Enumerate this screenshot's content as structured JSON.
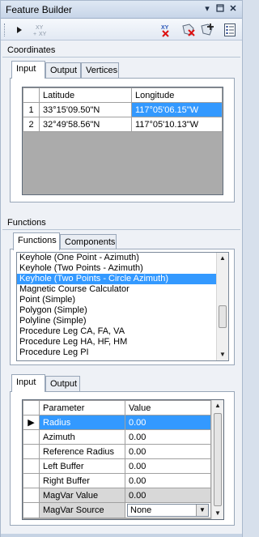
{
  "window": {
    "title": "Feature Builder"
  },
  "titlebar_buttons": [
    "dropdown-icon",
    "pin-icon",
    "close-icon"
  ],
  "toolbar": {
    "tools": [
      "select-arrow-icon",
      "xy-to-xy-icon",
      "clear-xy-icon",
      "delete-feature-icon",
      "add-feature-icon",
      "properties-icon"
    ],
    "xy_label": "XY"
  },
  "coordinates": {
    "label": "Coordinates",
    "tabs": [
      "Input",
      "Output",
      "Vertices"
    ],
    "active_tab": "Input",
    "columns": [
      "Latitude",
      "Longitude"
    ],
    "rows": [
      {
        "index": "1",
        "latitude": "33°15'09.50\"N",
        "longitude": "117°05'06.15\"W"
      },
      {
        "index": "2",
        "latitude": "32°49'58.56\"N",
        "longitude": "117°05'10.13\"W"
      }
    ]
  },
  "functions": {
    "label": "Functions",
    "tabs": [
      "Functions",
      "Components"
    ],
    "active_tab": "Functions",
    "items": [
      "Keyhole (One Point - Azimuth)",
      "Keyhole (Two Points - Azimuth)",
      "Keyhole (Two Points - Circle Azimuth)",
      "Magnetic Course Calculator",
      "Point (Simple)",
      "Polygon (Simple)",
      "Polyline (Simple)",
      "Procedure Leg CA, FA, VA",
      "Procedure Leg HA, HF, HM",
      "Procedure Leg PI"
    ],
    "selected_index": 2
  },
  "parameters": {
    "tabs": [
      "Input",
      "Output"
    ],
    "active_tab": "Input",
    "columns": [
      "Parameter",
      "Value"
    ],
    "rows": [
      {
        "name": "Radius",
        "value": "0.00"
      },
      {
        "name": "Azimuth",
        "value": "0.00"
      },
      {
        "name": "Reference Radius",
        "value": "0.00"
      },
      {
        "name": "Left Buffer",
        "value": "0.00"
      },
      {
        "name": "Right Buffer",
        "value": "0.00"
      },
      {
        "name": "MagVar Value",
        "value": "0.00"
      },
      {
        "name": "MagVar Source",
        "value": "None"
      }
    ]
  },
  "colors": {
    "selection": "#3399ff",
    "window_bg": "#eef1f6",
    "grid_empty": "#ababab"
  }
}
